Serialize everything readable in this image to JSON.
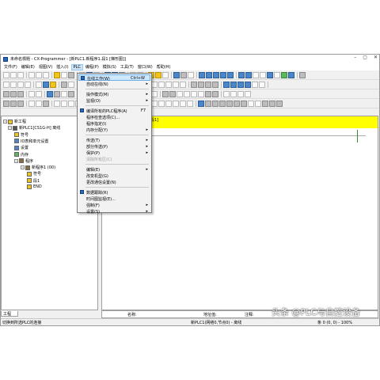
{
  "window": {
    "title": "未命名標題 - CX-Programmer - [新PLC1.新程序1.段1 [梯形图]]",
    "controls": [
      "–",
      "▢",
      "✕"
    ]
  },
  "menubar": [
    {
      "label": "文件(F)"
    },
    {
      "label": "编辑(E)"
    },
    {
      "label": "视图(V)"
    },
    {
      "label": "插入(I)"
    },
    {
      "label": "PLC",
      "active": true
    },
    {
      "label": "编程(P)"
    },
    {
      "label": "模拟(S)"
    },
    {
      "label": "工具(T)"
    },
    {
      "label": "窗口(W)"
    },
    {
      "label": "帮助(H)"
    }
  ],
  "tree": {
    "items": [
      {
        "label": "新工程",
        "expand": "−",
        "icon": "project-icon",
        "color": "#f0c419"
      },
      {
        "label": "新PLC1[CS1G-H] 离线",
        "expand": "−",
        "icon": "plc-icon",
        "color": "#555555"
      },
      {
        "label": "符号",
        "icon": "symbols-icon",
        "color": "#f0c419"
      },
      {
        "label": "IO表和单元设置",
        "icon": "io-table-icon",
        "color": "#4a86c8"
      },
      {
        "label": "设置",
        "icon": "settings-icon",
        "color": "#4a86c8"
      },
      {
        "label": "内存",
        "icon": "memory-icon",
        "color": "#5cb85c"
      },
      {
        "label": "程序",
        "expand": "−",
        "icon": "programs-icon",
        "color": "#8a6d3b"
      },
      {
        "label": "新程序1 (00)",
        "expand": "−",
        "icon": "program-icon",
        "color": "#8a6d3b"
      },
      {
        "label": "符号",
        "icon": "symbols-icon",
        "color": "#f0c419"
      },
      {
        "label": "段1",
        "icon": "section-icon",
        "color": "#f0c419"
      },
      {
        "label": "END",
        "icon": "end-section-icon",
        "color": "#f0c419"
      }
    ],
    "tab_label": "工程"
  },
  "editor": {
    "section_label": "段1]",
    "band_color": "#ffff00"
  },
  "grid_header": {
    "name_label": "名称:",
    "address_label": "地址值:",
    "comment_label": "注释:"
  },
  "status": {
    "left": "切换到所选PLC的连接",
    "center": "新PLC1(网络0,节点0) - 离线",
    "right": "条 0 (0, 0) - 100%"
  },
  "plc_menu": {
    "items": [
      {
        "label": "在线工作(W)",
        "shortcut": "Ctrl+W",
        "active": true,
        "icon": "online-icon"
      },
      {
        "label": "自动在线(N)",
        "submenu": true
      },
      {
        "sep": true
      },
      {
        "label": "操作模式(M)",
        "submenu": true
      },
      {
        "label": "监视(O)",
        "submenu": true
      },
      {
        "sep": true
      },
      {
        "label": "编译所有的PLC程序(A)",
        "shortcut": "F7",
        "icon": "compile-icon"
      },
      {
        "label": "程序检查选项(C)..."
      },
      {
        "label": "程序指定(I)"
      },
      {
        "label": "内存分配(Y)",
        "submenu": true
      },
      {
        "sep": true
      },
      {
        "label": "传送(T)",
        "submenu": true
      },
      {
        "label": "部分传送(P)",
        "submenu": true
      },
      {
        "label": "保护(P)",
        "submenu": true
      },
      {
        "label": "清除所有区(C)",
        "disabled": true
      },
      {
        "sep": true
      },
      {
        "label": "编辑(E)",
        "submenu": true
      },
      {
        "label": "改变机型(G)"
      },
      {
        "label": "更改通信设置(N)"
      },
      {
        "sep": true
      },
      {
        "label": "数据跟踪(R)",
        "icon": "trace-icon"
      },
      {
        "label": "时间图监视(E)..."
      },
      {
        "label": "强制(F)",
        "submenu": true
      },
      {
        "label": "设置(S)",
        "submenu": true
      }
    ]
  },
  "watermark": "头条 @PLC与自控设备"
}
